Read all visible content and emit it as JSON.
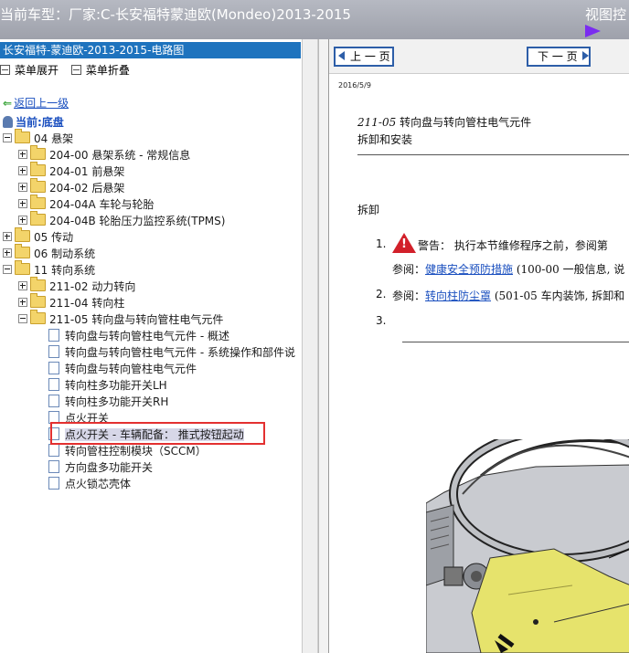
{
  "header": {
    "title": "当前车型：厂家:C-长安福特蒙迪欧(Mondeo)2013-2015",
    "view_label": "视图控"
  },
  "left_pane": {
    "title": "长安福特-蒙迪欧-2013-2015-电路图",
    "expand_all": "菜单展开",
    "collapse_all": "菜单折叠",
    "back_link": "返回上一级",
    "current": "当前:底盘"
  },
  "tree": {
    "items": [
      {
        "label": "04 悬架"
      },
      {
        "label": "204-00 悬架系统 - 常规信息"
      },
      {
        "label": "204-01 前悬架"
      },
      {
        "label": "204-02 后悬架"
      },
      {
        "label": "204-04A 车轮与轮胎"
      },
      {
        "label": "204-04B 轮胎压力监控系统(TPMS)"
      },
      {
        "label": "05 传动"
      },
      {
        "label": "06 制动系统"
      },
      {
        "label": "11 转向系统"
      },
      {
        "label": "211-02 动力转向"
      },
      {
        "label": "211-04 转向柱"
      },
      {
        "label": "211-05 转向盘与转向管柱电气元件"
      },
      {
        "label": "转向盘与转向管柱电气元件 - 概述"
      },
      {
        "label": "转向盘与转向管柱电气元件 - 系统操作和部件说"
      },
      {
        "label": "转向盘与转向管柱电气元件"
      },
      {
        "label": "转向柱多功能开关LH"
      },
      {
        "label": "转向柱多功能开关RH"
      },
      {
        "label": "点火开关"
      },
      {
        "label": "点火开关 - 车辆配备： 推式按钮起动"
      },
      {
        "label": "转向管柱控制模块（SCCM）"
      },
      {
        "label": "方向盘多功能开关"
      },
      {
        "label": "点火锁芯壳体"
      }
    ]
  },
  "doc": {
    "prev_label": "上 一 页",
    "next_label": "下 一 页",
    "date": "2016/5/9",
    "section_code": "211-05",
    "section_title": "转向盘与转向管柱电气元件",
    "subtitle": "拆卸和安装",
    "removal": "拆卸",
    "step1_num": "1.",
    "step1_text": "警告： 执行本节维修程序之前，参阅第",
    "step1_ref_prefix": "参阅：",
    "step1_ref_link": "健康安全预防措施",
    "step1_ref_suffix": " (100-00 一般信息, 说",
    "step2_num": "2.",
    "step2_prefix": "参阅：",
    "step2_link": "转向柱防尘罩",
    "step2_suffix": " (501-05 车内装饰, 拆卸和",
    "step3_num": "3."
  },
  "colors": {
    "header_bg": "#a9acb6",
    "pane_title_bg": "#1e73be",
    "link": "#1a4fbf",
    "highlight_box": "#e33030",
    "folder": "#f3d46a",
    "figure_yellow": "#e6e36c"
  }
}
